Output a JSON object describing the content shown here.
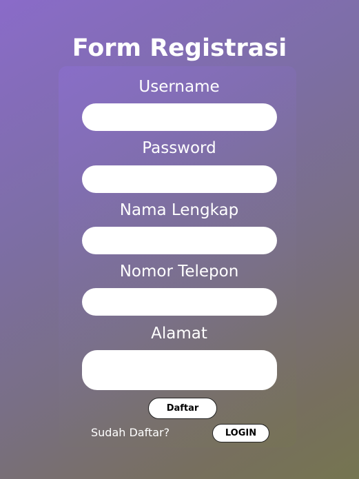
{
  "page": {
    "title": "Form Registrasi"
  },
  "form": {
    "fields": [
      {
        "label": "Username",
        "value": "",
        "placeholder": ""
      },
      {
        "label": "Password",
        "value": "",
        "placeholder": ""
      },
      {
        "label": "Nama Lengkap",
        "value": "",
        "placeholder": ""
      },
      {
        "label": "Nomor Telepon",
        "value": "",
        "placeholder": ""
      },
      {
        "label": "Alamat",
        "value": "",
        "placeholder": ""
      }
    ],
    "submit_label": "Daftar",
    "login_prompt": "Sudah Daftar?",
    "login_label": "LOGIN"
  },
  "colors": {
    "background_start": "#8a6bc9",
    "background_end": "#757550",
    "input_background": "#ffffff",
    "text": "#ffffff"
  }
}
